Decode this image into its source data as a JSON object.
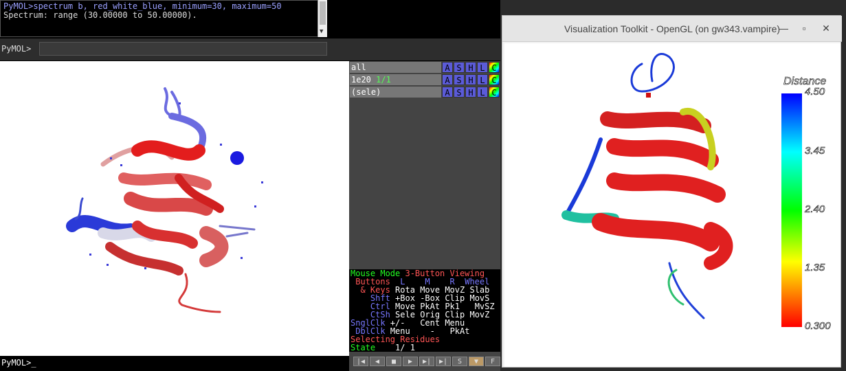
{
  "pymol": {
    "log_lines": [
      "PyMOL>spectrum b, red_white_blue, minimum=30, maximum=50",
      " Spectrum: range (30.00000 to 50.00000)."
    ],
    "prompt": "PyMOL>",
    "bottom_prompt": "PyMOL>_",
    "objects": [
      {
        "name": "all",
        "extra": ""
      },
      {
        "name": "1e20",
        "extra": "1/1"
      },
      {
        "name": "(sele)",
        "extra": ""
      }
    ],
    "obj_buttons": [
      "A",
      "S",
      "H",
      "L",
      "C"
    ],
    "mouse_mode": {
      "title": "Mouse Mode",
      "mode": "3-Button Viewing",
      "buttons_label": "Buttons",
      "cols": [
        "L",
        "M",
        "R",
        "Wheel"
      ],
      "keys_label": "& Keys",
      "rows": [
        {
          "key": "& Keys",
          "vals": [
            "Rota",
            "Move",
            "MovZ",
            "Slab"
          ]
        },
        {
          "key": "Shft",
          "vals": [
            "+Box",
            "-Box",
            "Clip",
            "MovS"
          ]
        },
        {
          "key": "Ctrl",
          "vals": [
            "Move",
            "PkAt",
            "Pk1",
            "MvSZ"
          ]
        },
        {
          "key": "CtSh",
          "vals": [
            "Sele",
            "Orig",
            "Clip",
            "MovZ"
          ]
        },
        {
          "key": "SnglClk",
          "vals": [
            "+/-",
            "Cent",
            "Menu",
            ""
          ]
        },
        {
          "key": "DblClk",
          "vals": [
            "Menu",
            "-",
            "PkAt",
            ""
          ]
        }
      ],
      "selecting": "Selecting Residues",
      "state_label": "State",
      "state_value": "1/   1"
    },
    "controls": [
      "|◀",
      "◀",
      "■",
      "▶",
      "▶|",
      "▶|",
      "S",
      "▼",
      "F"
    ]
  },
  "vtk": {
    "title": "Visualization Toolkit - OpenGL (on gw343.vampire)",
    "legend_title": "Distance",
    "legend_labels": [
      "4.50",
      "3.45",
      "2.40",
      "1.35",
      "0.300"
    ]
  }
}
